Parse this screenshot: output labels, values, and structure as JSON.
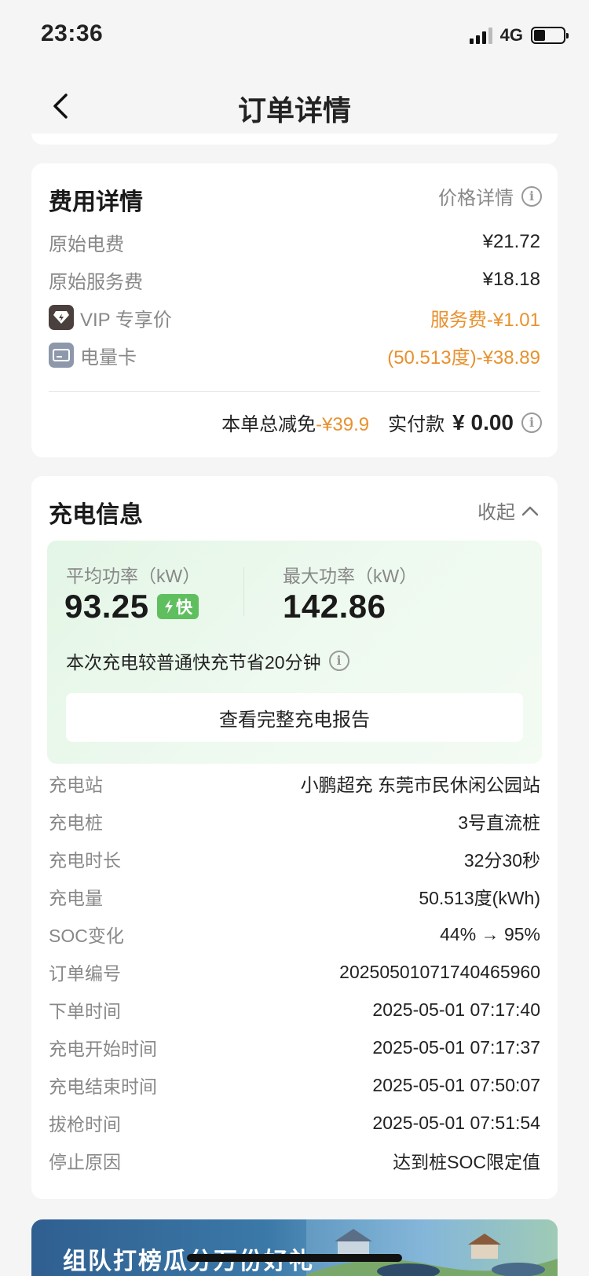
{
  "status": {
    "time": "23:36",
    "network": "4G"
  },
  "nav": {
    "title": "订单详情"
  },
  "fee": {
    "title": "费用详情",
    "price_detail_label": "价格详情",
    "rows": [
      {
        "label": "原始电费",
        "value": "¥21.72"
      },
      {
        "label": "原始服务费",
        "value": "¥18.18"
      },
      {
        "label": "VIP 专享价",
        "value": "服务费-¥1.01"
      },
      {
        "label": "电量卡",
        "value": "(50.513度)-¥38.89"
      }
    ],
    "total_discount_label": "本单总减免",
    "total_discount_value": "-¥39.9",
    "paid_label": "实付款",
    "paid_value": "¥ 0.00"
  },
  "charge": {
    "title": "充电信息",
    "collapse_label": "收起",
    "avg_power_label": "平均功率（kW）",
    "avg_power_value": "93.25",
    "fast_badge": "快",
    "max_power_label": "最大功率（kW）",
    "max_power_value": "142.86",
    "saving_text": "本次充电较普通快充节省20分钟",
    "report_button": "查看完整充电报告",
    "rows": [
      {
        "label": "充电站",
        "value": "小鹏超充 东莞市民休闲公园站"
      },
      {
        "label": "充电桩",
        "value": "3号直流桩"
      },
      {
        "label": "充电时长",
        "value": "32分30秒"
      },
      {
        "label": "充电量",
        "value": "50.513度(kWh)"
      },
      {
        "label": "SOC变化",
        "value": "44% → 95%"
      },
      {
        "label": "订单编号",
        "value": "20250501071740465960"
      },
      {
        "label": "下单时间",
        "value": "2025-05-01 07:17:40"
      },
      {
        "label": "充电开始时间",
        "value": "2025-05-01 07:17:37"
      },
      {
        "label": "充电结束时间",
        "value": "2025-05-01 07:50:07"
      },
      {
        "label": "拔枪时间",
        "value": "2025-05-01 07:51:54"
      },
      {
        "label": "停止原因",
        "value": "达到桩SOC限定值"
      }
    ]
  },
  "banner": {
    "text": "组队打榜瓜分万份好礼"
  },
  "colors": {
    "accent_orange": "#e8912e",
    "fast_green": "#5fbf5f",
    "panel_green": "#e3f6e6"
  }
}
